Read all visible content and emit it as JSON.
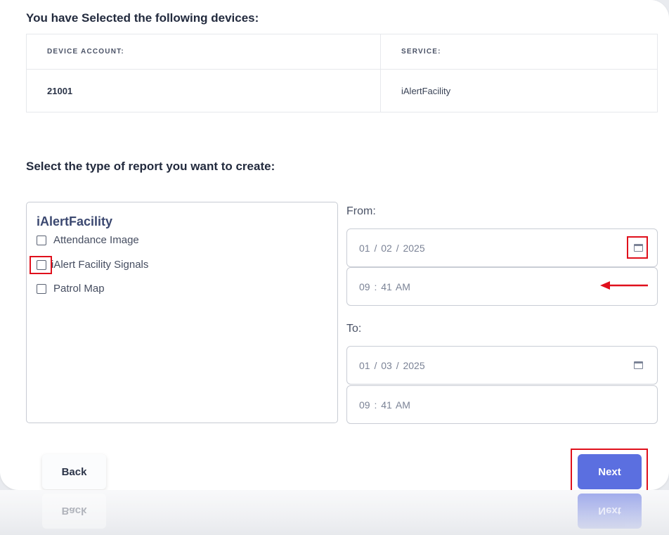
{
  "selected_heading": "You have Selected the following devices:",
  "device_table": {
    "headers": [
      "DEVICE ACCOUNT:",
      "SERVICE:"
    ],
    "rows": [
      [
        "21001",
        "iAlertFacility"
      ]
    ]
  },
  "report_heading": "Select the type of report you want to create:",
  "report_group": {
    "title": "iAlertFacility",
    "options": [
      {
        "label": "Attendance Image",
        "checked": false
      },
      {
        "label": "iAlert Facility Signals",
        "checked": false
      },
      {
        "label": "Patrol Map",
        "checked": false
      }
    ]
  },
  "from": {
    "label": "From:",
    "date": "01 / 02 / 2025",
    "time": "09 : 41  AM"
  },
  "to": {
    "label": "To:",
    "date": "01 / 03 / 2025",
    "time": "09 : 41  AM"
  },
  "buttons": {
    "back": "Back",
    "next": "Next"
  },
  "annotation_color": "#e0101c",
  "accent_color": "#5b6fe0",
  "icons": [
    "calendar-icon",
    "arrow-left-icon"
  ]
}
